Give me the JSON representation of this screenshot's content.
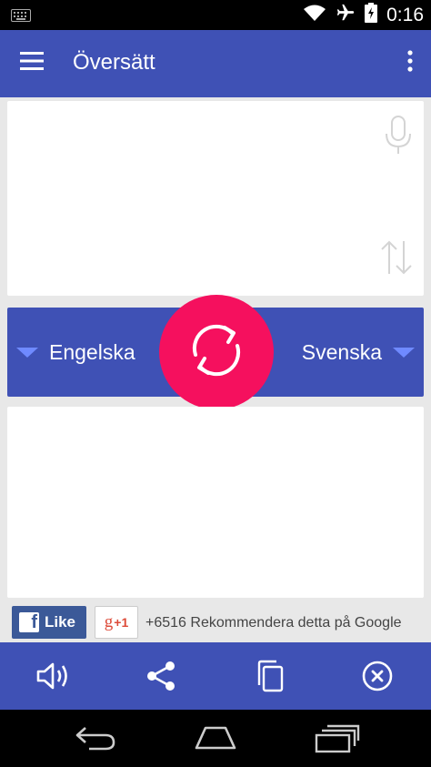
{
  "status_bar": {
    "time": "0:16"
  },
  "app_bar": {
    "title": "Översätt"
  },
  "languages": {
    "source": "Engelska",
    "target": "Svenska"
  },
  "social": {
    "like_label": "Like",
    "gplus_label": "g",
    "gplus_plus": "+1",
    "recommend_text": "+6516 Rekommendera detta på Google"
  },
  "colors": {
    "primary": "#3f51b5",
    "accent": "#f5105e",
    "facebook": "#3b5998"
  }
}
